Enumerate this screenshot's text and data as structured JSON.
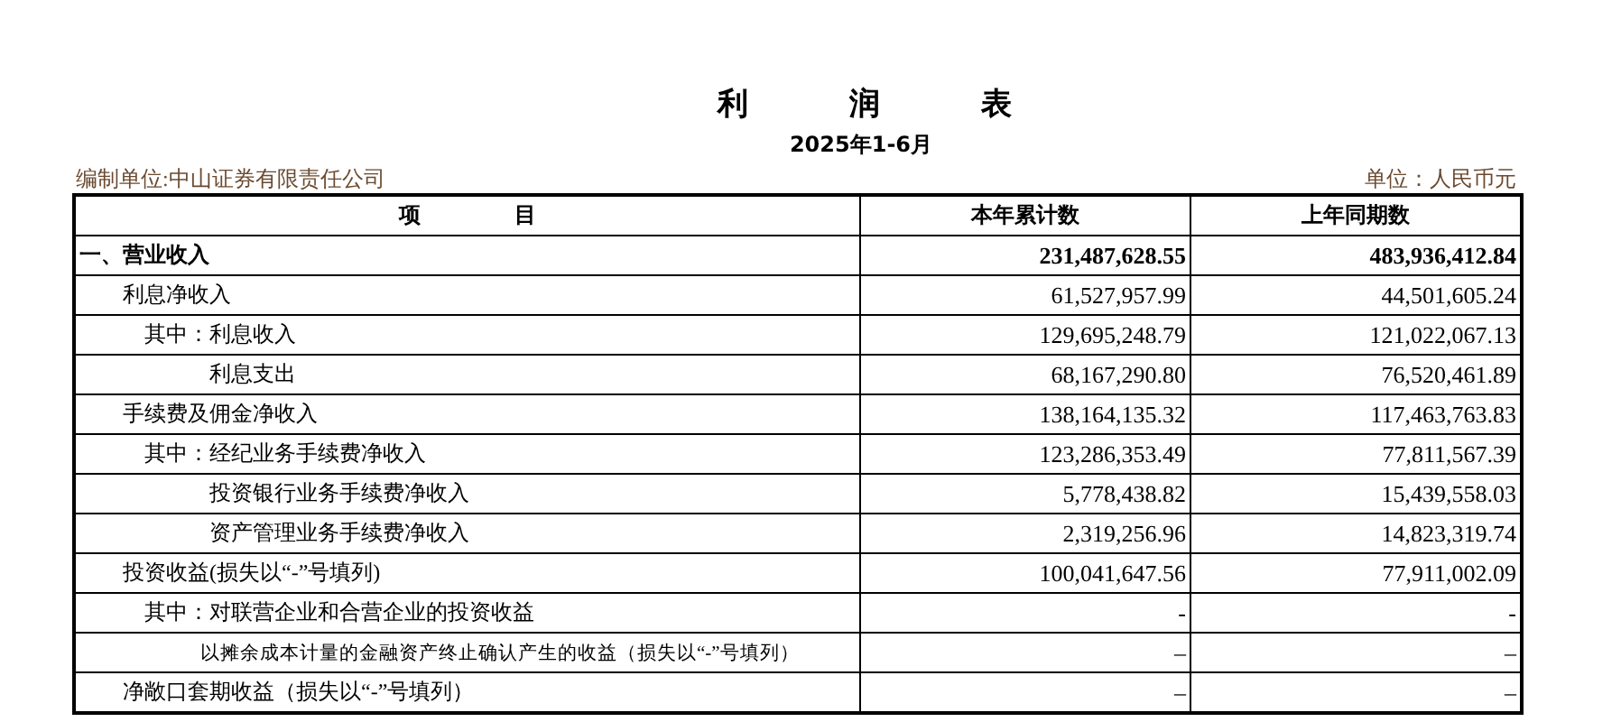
{
  "title": "利 润 表",
  "period": "2025年1-6月",
  "company": "编制单位:中山证券有限责任公司",
  "unit": "单位：人民币元",
  "table": {
    "columns": [
      "项 目",
      "本年累计数",
      "上年同期数"
    ],
    "rows": [
      {
        "label": "一、营业收入",
        "current": "231,487,628.55",
        "previous": "483,936,412.84",
        "children": [
          {
            "label": "利息净收入",
            "current": "61,527,957.99",
            "previous": "44,501,605.24",
            "children": [
              {
                "prefix": "其中：",
                "label": "利息收入",
                "current": "129,695,248.79",
                "previous": "121,022,067.13"
              },
              {
                "label": "利息支出",
                "current": "68,167,290.80",
                "previous": "76,520,461.89"
              }
            ]
          },
          {
            "label": "手续费及佣金净收入",
            "current": "138,164,135.32",
            "previous": "117,463,763.83",
            "children": [
              {
                "prefix": "其中：",
                "label": "经纪业务手续费净收入",
                "current": "123,286,353.49",
                "previous": "77,811,567.39"
              },
              {
                "label": "投资银行业务手续费净收入",
                "current": "5,778,438.82",
                "previous": "15,439,558.03"
              },
              {
                "label": "资产管理业务手续费净收入",
                "current": "2,319,256.96",
                "previous": "14,823,319.74"
              }
            ]
          },
          {
            "label": "投资收益(损失以“-”号填列)",
            "current": "100,041,647.56",
            "previous": "77,911,002.09",
            "children": [
              {
                "prefix": "其中：",
                "label": "对联营企业和合营企业的投资收益",
                "current": "-",
                "previous": "-"
              },
              {
                "kind": "note",
                "label": "以摊余成本计量的金融资产终止确认产生的收益（损失以“-”号填列）",
                "current": "–",
                "previous": "–"
              }
            ]
          },
          {
            "label": "净敞口套期收益（损失以“-”号填列）",
            "current": "–",
            "previous": "–"
          }
        ]
      }
    ]
  }
}
